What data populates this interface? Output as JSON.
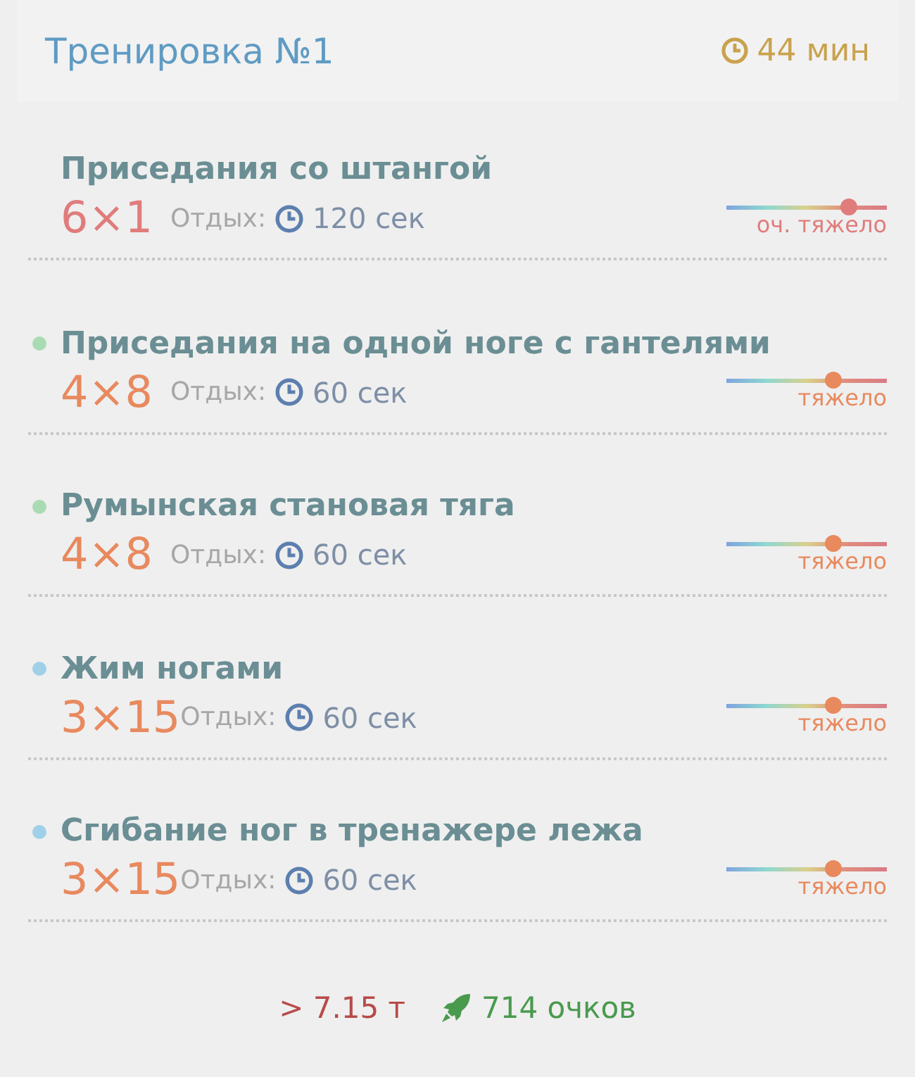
{
  "header": {
    "title": "Тренировка №1",
    "duration": "44 мин"
  },
  "exercises": [
    {
      "name": "Приседания со штангой",
      "sets": "6×1",
      "rest_label": "Отдых:",
      "rest": "120 сек",
      "level": 0.76,
      "difficulty": "оч. тяжело"
    },
    {
      "name": "Приседания на одной ноге с гантелями",
      "color": "#a9dbb3",
      "sets": "4×8",
      "rest_label": "Отдых:",
      "rest": "60 сек",
      "level": 0.67,
      "difficulty": "тяжело"
    },
    {
      "name": "Румынская становая тяга",
      "color": "#a9dbb3",
      "sets": "4×8",
      "rest_label": "Отдых:",
      "rest": "60 сек",
      "level": 0.67,
      "difficulty": "тяжело"
    },
    {
      "name": "Жим ногами",
      "color": "#9fd0e8",
      "sets": "3×15",
      "rest_label": "Отдых:",
      "rest": "60 сек",
      "level": 0.67,
      "difficulty": "тяжело"
    },
    {
      "name": "Сгибание ног в тренажере лежа",
      "color": "#9fd0e8",
      "sets": "3×15",
      "rest_label": "Отдых:",
      "rest": "60 сек",
      "level": 0.67,
      "difficulty": "тяжело"
    }
  ],
  "footer": {
    "tonnage": "> 7.15 т",
    "points": "714 очков"
  }
}
